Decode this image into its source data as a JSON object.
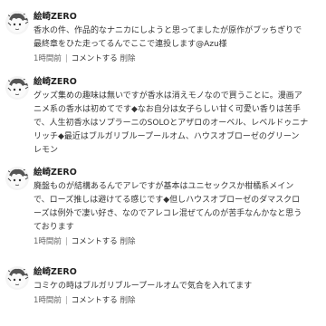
{
  "comments": [
    {
      "author": "絵崎ZERO",
      "lines": [
        "香水の件、作品的なナニカにしようと思ってましたが原作がブッちぎりで",
        "最終章をひた走ってるんでここで連投します@Azu様"
      ],
      "time": "1時間前",
      "reply_label": "コメントする",
      "delete_label": "削除"
    },
    {
      "author": "絵崎ZERO",
      "lines": [
        "グッズ集めの趣味は無いですが香水は消えモノなので買うことに。漫画ア",
        "ニメ系の香水は初めてです◆なお自分は女子らしい甘く可愛い香りは苦手",
        "で、人生初香水はソプラーニのSOLOとアザロのオーベル、レベルドゥニナ",
        "リッチ◆最近はブルガリブループールオム、ハウスオブローゼのグリーン",
        "レモン"
      ],
      "time": "1時間前",
      "reply_label": "コメントする",
      "delete_label": "削除"
    },
    {
      "author": "絵崎ZERO",
      "lines": [
        "廃盤ものが結構あるんでアレですが基本はユニセックスか柑橘系メイン",
        "で、ローズ推しは避けてる感じです◆但しハウスオブローゼのダマスクロ",
        "ーズは例外で凄い好き、なのでアレコレ混ぜてんのが苦手なんかなと思う",
        "ております"
      ],
      "time": "1時間前",
      "reply_label": "コメントする",
      "delete_label": "削除"
    },
    {
      "author": "絵崎ZERO",
      "lines": [
        "コミケの時はブルガリブループールオムで気合を入れてます"
      ],
      "time": "1時間前",
      "reply_label": "コメントする",
      "delete_label": "削除"
    }
  ]
}
